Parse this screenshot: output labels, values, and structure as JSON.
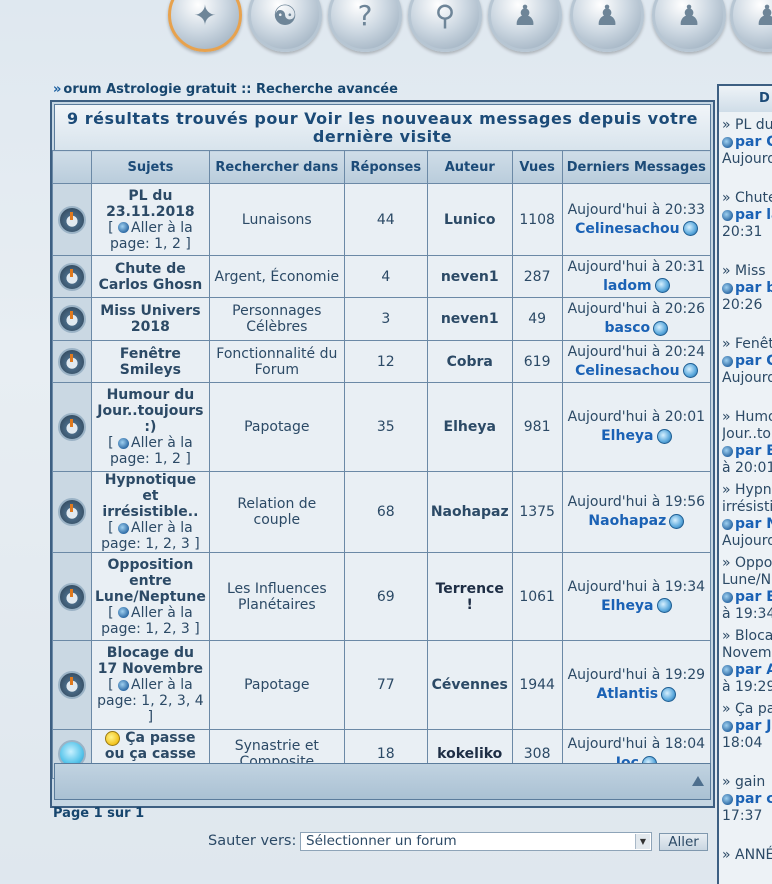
{
  "nav_icons": [
    "astrology-wheel-icon",
    "help-icon",
    "search-icon",
    "members-icon",
    "groups-icon",
    "users-icon"
  ],
  "breadcrumb": {
    "text": "orum Astrologie gratuit :: Recherche avancée"
  },
  "results": {
    "title": "9 résultats trouvés pour Voir les nouveaux messages depuis votre dernière visite",
    "headers": [
      "Sujets",
      "Rechercher dans",
      "Réponses",
      "Auteur",
      "Vues",
      "Derniers Messages"
    ],
    "rows": [
      {
        "subject": "PL du 23.11.2018",
        "goto": "Aller à la page: 1, 2 ]",
        "forum": "Lunaisons",
        "replies": "44",
        "author": "Lunico",
        "views": "1108",
        "last_date": "Aujourd'hui à 20:33",
        "last_by": "Celinesachou"
      },
      {
        "subject": "Chute de Carlos Ghosn",
        "goto": "",
        "forum": "Argent, Économie",
        "replies": "4",
        "author": "neven1",
        "views": "287",
        "last_date": "Aujourd'hui à 20:31",
        "last_by": "ladom"
      },
      {
        "subject": "Miss Univers 2018",
        "goto": "",
        "forum": "Personnages Célèbres",
        "replies": "3",
        "author": "neven1",
        "views": "49",
        "last_date": "Aujourd'hui à 20:26",
        "last_by": "basco"
      },
      {
        "subject": "Fenêtre Smileys",
        "goto": "",
        "forum": "Fonctionnalité du Forum",
        "replies": "12",
        "author": "Cobra",
        "views": "619",
        "last_date": "Aujourd'hui à 20:24",
        "last_by": "Celinesachou"
      },
      {
        "subject": "Humour du Jour..toujours :)",
        "goto": "Aller à la page: 1, 2 ]",
        "forum": "Papotage",
        "replies": "35",
        "author": "Elheya",
        "views": "981",
        "last_date": "Aujourd'hui à 20:01",
        "last_by": "Elheya"
      },
      {
        "subject": "Hypnotique et irrésistible..",
        "goto": "Aller à la page: 1, 2, 3 ]",
        "forum": "Relation de couple",
        "replies": "68",
        "author": "Naohapaz",
        "views": "1375",
        "last_date": "Aujourd'hui à 19:56",
        "last_by": "Naohapaz"
      },
      {
        "subject": "Opposition entre Lune/Neptune",
        "goto": "Aller à la page: 1, 2, 3 ]",
        "forum": "Les Influences Planétaires",
        "replies": "69",
        "author": "Terrence !",
        "views": "1061",
        "last_date": "Aujourd'hui à 19:34",
        "last_by": "Elheya"
      },
      {
        "subject": "Blocage du 17 Novembre",
        "goto": "Aller à la page: 1, 2, 3, 4 ]",
        "forum": "Papotage",
        "replies": "77",
        "author": "Cévennes",
        "views": "1944",
        "last_date": "Aujourd'hui à 19:29",
        "last_by": "Atlantis"
      },
      {
        "subject": "Ça passe ou ça casse ??",
        "goto": "",
        "forum": "Synastrie et Composite",
        "replies": "18",
        "author": "kokeliko",
        "views": "308",
        "last_date": "Aujourd'hui à 18:04",
        "last_by": "Joc"
      }
    ]
  },
  "pagination": "Page 1 sur 1",
  "jump": {
    "label": "Sauter vers:",
    "selected": "Sélectionner un forum",
    "button": "Aller"
  },
  "sidebar": {
    "title": "D",
    "items": [
      {
        "l1": "» PL du",
        "l2": "par C",
        "l3": "Aujourd"
      },
      {
        "l1": "» Chute",
        "l2": "par la",
        "l3": "20:31"
      },
      {
        "l1": "» Miss",
        "l2": "par ba",
        "l3": "20:26"
      },
      {
        "l1": "» Fenêt",
        "l2": "par C",
        "l3": "Aujourd"
      },
      {
        "l1": "» Humo",
        "l2": "Jour..to",
        "l3": "par El",
        "l4": "à 20:01"
      },
      {
        "l1": "» Hypn",
        "l2": "irrésisti",
        "l3": "par N",
        "l4": "Aujourd"
      },
      {
        "l1": "» Oppo",
        "l2": "Lune/N",
        "l3": "par El",
        "l4": "à 19:34"
      },
      {
        "l1": "» Bloca",
        "l2": "Novemb",
        "l3": "par At",
        "l4": "à 19:29"
      },
      {
        "l1": "» Ça pa",
        "l2": "par Jo",
        "l3": "18:04"
      },
      {
        "l1": "» gain",
        "l2": "par ca",
        "l3": "17:37"
      },
      {
        "l1": "» ANNÉ",
        "l2": "",
        "l3": ""
      }
    ]
  }
}
